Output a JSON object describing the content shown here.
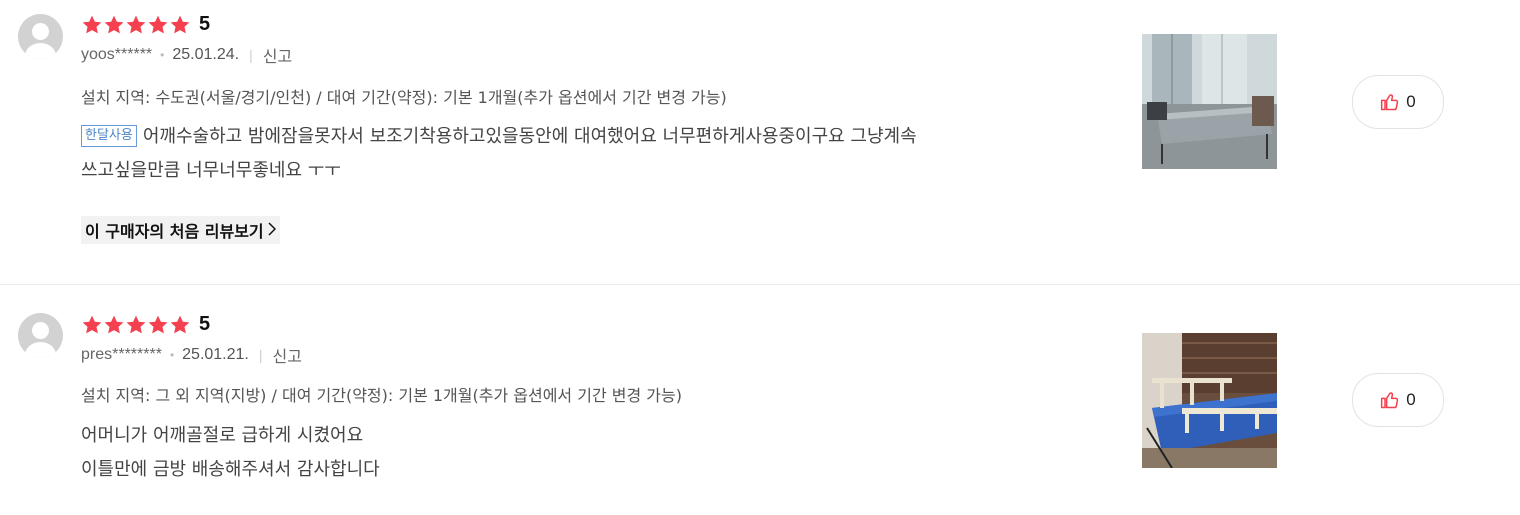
{
  "reviews": [
    {
      "rating": "5",
      "user": "yoos******",
      "date": "25.01.24.",
      "report_label": "신고",
      "option": "설치 지역: 수도권(서울/경기/인천) / 대여 기간(약정): 기본 1개월(추가 옵션에서 기간 변경 가능)",
      "badge": "한달사용",
      "content_line1": "어깨수술하고 밤에잠을못자서 보조기착용하고있을동안에 대여했어요 너무편하게사용중이구요 그냥계속",
      "content_line2": "쓰고싶을만큼 너무너무좋네요 ㅜㅜ",
      "first_review_link": "이 구매자의 처음 리뷰보기",
      "likes": "0"
    },
    {
      "rating": "5",
      "user": "pres********",
      "date": "25.01.21.",
      "report_label": "신고",
      "option": "설치 지역: 그 외 지역(지방) / 대여 기간(약정): 기본 1개월(추가 옵션에서 기간 변경 가능)",
      "content_line1": "어머니가 어깨골절로 급하게 시켰어요",
      "content_line2": "이틀만에 금방 배송해주셔서 감사합니다",
      "likes": "0"
    }
  ],
  "icons": {
    "star": "star-icon",
    "like": "thumbs-up-icon",
    "avatar": "user-avatar-icon",
    "chevron": "chevron-right-icon"
  },
  "colors": {
    "star": "#f4404f",
    "like_icon": "#f4404f",
    "badge": "#4b86cc"
  }
}
